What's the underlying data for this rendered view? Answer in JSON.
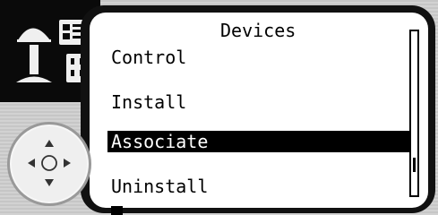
{
  "screen": {
    "title": "Devices",
    "menu": [
      {
        "label": "Control",
        "selected": false
      },
      {
        "label": "Install",
        "selected": false
      },
      {
        "label": "Associate",
        "selected": true
      },
      {
        "label": "Uninstall",
        "selected": false
      }
    ],
    "scroll_position": 0.67
  },
  "icons": {
    "device_icon": "lamp-with-remote-and-outlet-icon",
    "dpad": "navigation-dpad"
  },
  "colors": {
    "highlight": "#000000",
    "screen_bg": "#ffffff",
    "frame": "#111111"
  }
}
